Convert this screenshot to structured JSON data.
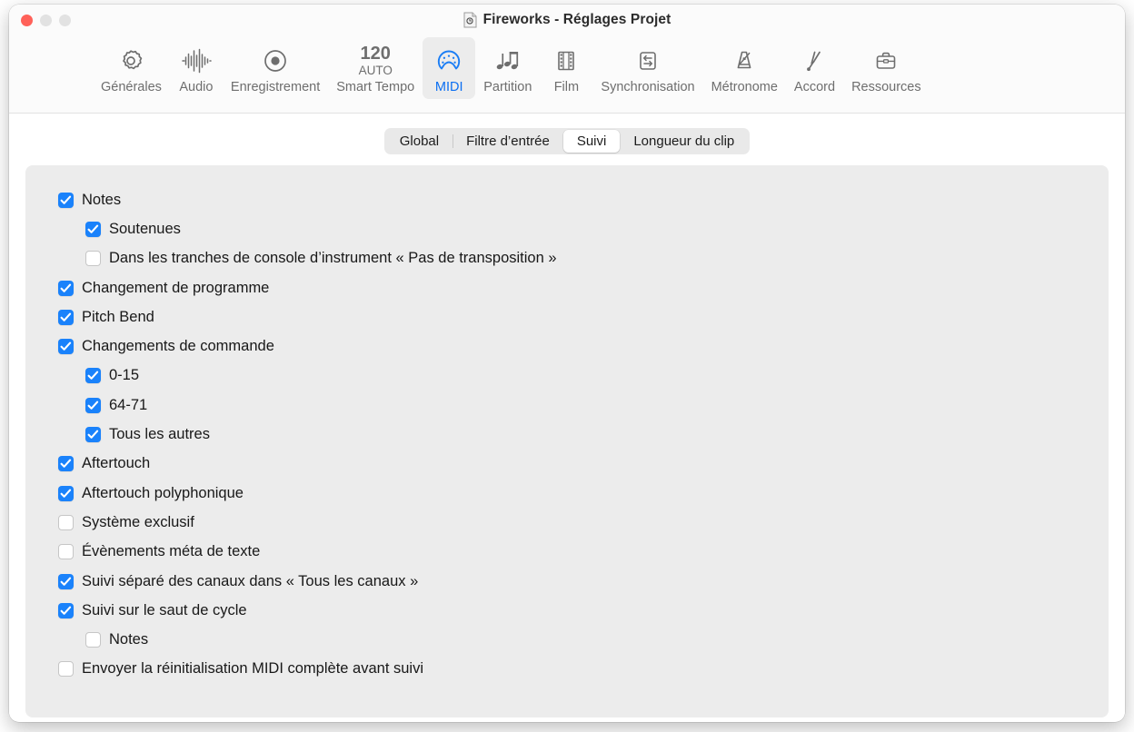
{
  "window": {
    "title": "Fireworks - Réglages Projet",
    "doc_icon": "document-icon",
    "traffic_lights": {
      "close": "close-button",
      "minimize": "minimize-button",
      "maximize": "maximize-button"
    },
    "accent_color": "#1a82fb",
    "selected_tool_label_color": "#0b6ff2",
    "panel_background": "#ececec",
    "toolbar_background": "#fbfbfb"
  },
  "toolbar": {
    "items": [
      {
        "label": "Générales",
        "icon": "gear-icon",
        "selected": false
      },
      {
        "label": "Audio",
        "icon": "waveform-icon",
        "selected": false
      },
      {
        "label": "Enregistrement",
        "icon": "record-icon",
        "selected": false
      },
      {
        "label": "Smart Tempo",
        "icon": "tempo-icon",
        "selected": false,
        "tempo_value": "120",
        "tempo_mode": "AUTO"
      },
      {
        "label": "MIDI",
        "icon": "midi-din-icon",
        "selected": true
      },
      {
        "label": "Partition",
        "icon": "music-notes-icon",
        "selected": false
      },
      {
        "label": "Film",
        "icon": "film-strip-icon",
        "selected": false
      },
      {
        "label": "Synchronisation",
        "icon": "sync-arrows-icon",
        "selected": false
      },
      {
        "label": "Métronome",
        "icon": "metronome-icon",
        "selected": false
      },
      {
        "label": "Accord",
        "icon": "tuning-fork-icon",
        "selected": false
      },
      {
        "label": "Ressources",
        "icon": "briefcase-icon",
        "selected": false
      }
    ]
  },
  "tabs": [
    {
      "label": "Global",
      "selected": false
    },
    {
      "label": "Filtre d’entrée",
      "selected": false
    },
    {
      "label": "Suivi",
      "selected": true
    },
    {
      "label": "Longueur du clip",
      "selected": false
    }
  ],
  "options": [
    {
      "label": "Notes",
      "checked": true,
      "indent": 0
    },
    {
      "label": "Soutenues",
      "checked": true,
      "indent": 1
    },
    {
      "label": "Dans les tranches de console d’instrument « Pas de transposition »",
      "checked": false,
      "indent": 1
    },
    {
      "label": "Changement de programme",
      "checked": true,
      "indent": 0
    },
    {
      "label": "Pitch Bend",
      "checked": true,
      "indent": 0
    },
    {
      "label": "Changements de commande",
      "checked": true,
      "indent": 0
    },
    {
      "label": "0-15",
      "checked": true,
      "indent": 1
    },
    {
      "label": "64-71",
      "checked": true,
      "indent": 1
    },
    {
      "label": "Tous les autres",
      "checked": true,
      "indent": 1
    },
    {
      "label": "Aftertouch",
      "checked": true,
      "indent": 0
    },
    {
      "label": "Aftertouch polyphonique",
      "checked": true,
      "indent": 0
    },
    {
      "label": "Système exclusif",
      "checked": false,
      "indent": 0
    },
    {
      "label": "Évènements méta de texte",
      "checked": false,
      "indent": 0
    },
    {
      "label": "Suivi séparé des canaux dans « Tous les canaux »",
      "checked": true,
      "indent": 0
    },
    {
      "label": "Suivi sur le saut de cycle",
      "checked": true,
      "indent": 0
    },
    {
      "label": "Notes",
      "checked": false,
      "indent": 1
    },
    {
      "label": "Envoyer la réinitialisation MIDI complète avant suivi",
      "checked": false,
      "indent": 0
    }
  ]
}
